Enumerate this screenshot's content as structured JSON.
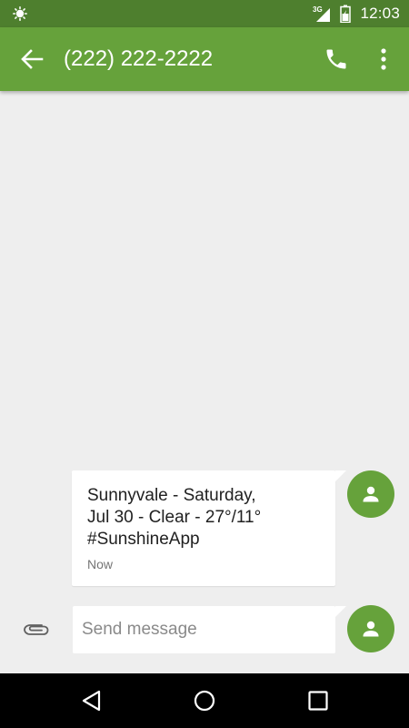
{
  "status_bar": {
    "time": "12:03",
    "network_label": "3G",
    "icons": [
      "brightness-icon",
      "signal-icon",
      "battery-icon"
    ]
  },
  "app_bar": {
    "title": "(222) 222-2222",
    "icons": [
      "back-arrow-icon",
      "phone-icon",
      "more-vert-icon"
    ]
  },
  "conversation": {
    "messages": [
      {
        "text": "Sunnyvale - Saturday,\nJul 30 - Clear - 27°/11°\n#SunshineApp",
        "time": "Now"
      }
    ]
  },
  "composer": {
    "placeholder": "Send message",
    "value": ""
  },
  "nav_bar": {
    "icons": [
      "nav-back-icon",
      "nav-home-icon",
      "nav-recents-icon"
    ]
  },
  "colors": {
    "status_bar": "#4e7f2e",
    "app_bar": "#66a23b",
    "background": "#eeeeee",
    "bubble": "#ffffff",
    "avatar": "#66a23b"
  }
}
